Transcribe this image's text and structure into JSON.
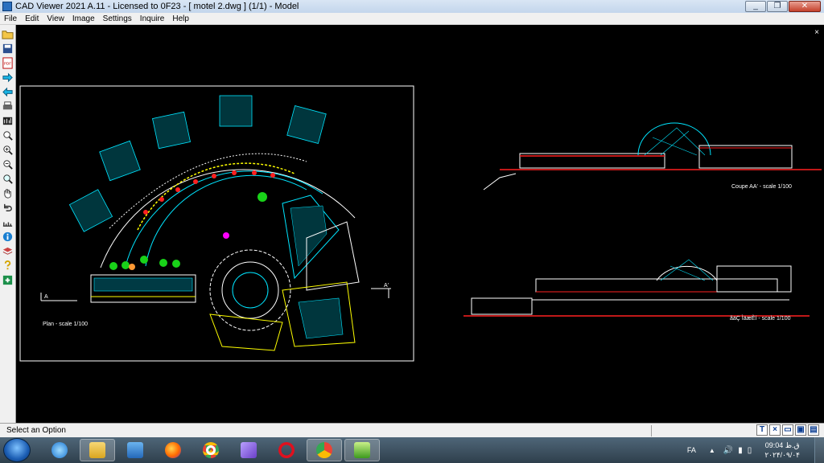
{
  "window": {
    "title": "CAD Viewer 2021 A.11 - Licensed to 0F23  -  [ motel 2.dwg ] (1/1)  -  Model",
    "minimize_label": "_",
    "maximize_label": "❐",
    "close_label": "✕"
  },
  "menu": {
    "items": [
      "File",
      "Edit",
      "View",
      "Image",
      "Settings",
      "Inquire",
      "Help"
    ]
  },
  "toolbar": {
    "buttons": [
      "open-folder-icon",
      "save-icon",
      "pdf-icon",
      "forward-arrow-icon",
      "back-arrow-icon",
      "print-icon",
      "plot-icon",
      "zoom-icon",
      "zoom-in-icon",
      "zoom-out-icon",
      "zoom-window-icon",
      "pan-hand-icon",
      "undo-icon",
      "measure-icon",
      "info-icon",
      "layers-icon",
      "help-icon",
      "settings-icon"
    ],
    "pdf_label": "PDF"
  },
  "canvas": {
    "close_label": "×",
    "plan_label": "Plan - scale 1/100",
    "section_label_a": "A",
    "section_label_a_prime": "A'",
    "coupe_label": "Coupe AA' - scale 1/100",
    "facade_label": "ãäÇ ÌäæÈí - scale 1/100",
    "colors": {
      "frame": "#ffffff",
      "cyan": "#00e5ff",
      "red": "#ff2020",
      "yellow": "#ffff00",
      "green": "#19d219",
      "magenta": "#ff00ff"
    }
  },
  "status": {
    "text": "Select an Option",
    "tools": [
      "T",
      "×",
      "▭",
      "▣",
      "▤"
    ]
  },
  "taskbar": {
    "apps": [
      "internet-explorer-icon",
      "file-explorer-icon",
      "media-player-icon",
      "firefox-icon",
      "chrome-icon",
      "visual-studio-icon",
      "opera-icon",
      "chrome-profile-icon",
      "cad-viewer-icon"
    ],
    "language": "FA",
    "time": "09:04 ق.ظ",
    "date": "۲۰۲۴/۰۹/۰۴"
  }
}
